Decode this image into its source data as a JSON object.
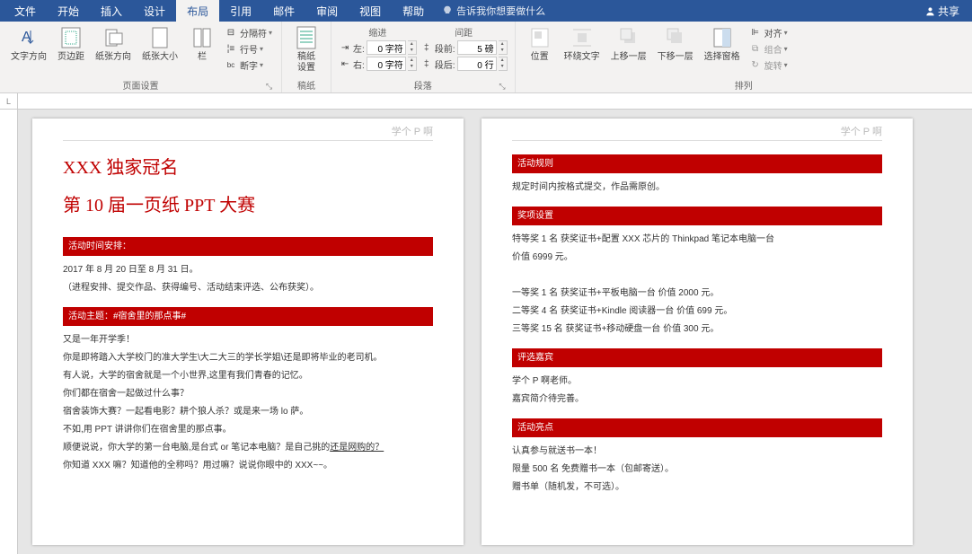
{
  "menubar": {
    "tabs": [
      "文件",
      "开始",
      "插入",
      "设计",
      "布局",
      "引用",
      "邮件",
      "审阅",
      "视图",
      "帮助"
    ],
    "activeIndex": 4,
    "tellMe": "告诉我你想要做什么",
    "share": "共享"
  },
  "ribbon": {
    "pageSetup": {
      "label": "页面设置",
      "textDirection": "文字方向",
      "margins": "页边距",
      "orientation": "纸张方向",
      "size": "纸张大小",
      "columns": "栏",
      "breaks": "分隔符",
      "lineNumbers": "行号",
      "hyphenation": "断字"
    },
    "draft": {
      "label": "稿纸",
      "settings": "稿纸\n设置"
    },
    "paragraph": {
      "label": "段落",
      "indent": "缩进",
      "spacing": "间距",
      "leftLabel": "左:",
      "leftValue": "0 字符",
      "rightLabel": "右:",
      "rightValue": "0 字符",
      "beforeLabel": "段前:",
      "beforeValue": "5 磅",
      "afterLabel": "段后:",
      "afterValue": "0 行"
    },
    "arrange": {
      "label": "排列",
      "position": "位置",
      "wrap": "环绕文字",
      "bringForward": "上移一层",
      "sendBackward": "下移一层",
      "selectionPane": "选择窗格",
      "align": "对齐",
      "group": "组合",
      "rotate": "旋转"
    }
  },
  "doc": {
    "headerText": "学个 P 啊",
    "page1": {
      "title1": "XXX 独家冠名",
      "title2": "第 10 届一页纸 PPT 大赛",
      "sec1": "活动时间安排：",
      "p1": "2017 年 8 月 20 日至 8 月 31 日。",
      "p2": "（进程安排、提交作品、获得编号、活动结束评选、公布获奖）。",
      "sec2": "活动主题：#宿舍里的那点事#",
      "p3": "又是一年开学季！",
      "p4": "你是即将踏入大学校门的准大学生\\大二大三的学长学姐\\还是即将毕业的老司机。",
      "p5": "有人说，大学的宿舍就是一个小世界,这里有我们青春的记忆。",
      "p6": "你们都在宿舍一起做过什么事？",
      "p7": "宿舍装饰大赛？一起看电影？耕个狼人杀？或是来一场 lo 萨。",
      "p8": "不如,用 PPT 讲讲你们在宿舍里的那点事。",
      "p9a": "顺便说说，你大学的第一台电脑,是台式 or 笔记本电脑？是自己挑的",
      "p9b": "还是网购的？",
      "p10": "你知道 XXX 嘛？知道他的全称吗？用过嘛？说说你眼中的 XXX~~。"
    },
    "page2": {
      "sec1": "活动规则",
      "p1": "规定时间内按格式提交，作品需原创。",
      "sec2": "奖项设置",
      "p2": "特等奖 1 名  获奖证书+配置 XXX 芯片的 Thinkpad 笔记本电脑一台",
      "p3": "价值 6999 元。",
      "p4": "一等奖 1 名  获奖证书+平板电脑一台  价值 2000 元。",
      "p5": "二等奖 4 名  获奖证书+Kindle 阅读器一台  价值 699 元。",
      "p6": "三等奖 15 名  获奖证书+移动硬盘一台    价值 300 元。",
      "sec3": "评选嘉宾",
      "p7": "学个 P 啊老师。",
      "p8": "嘉宾简介待完善。",
      "sec4": "活动亮点",
      "p9": "认真参与就送书一本！",
      "p10": "限量 500 名 免费赠书一本（包邮寄送）。",
      "p11": "赠书单（随机发，不可选）。"
    }
  }
}
